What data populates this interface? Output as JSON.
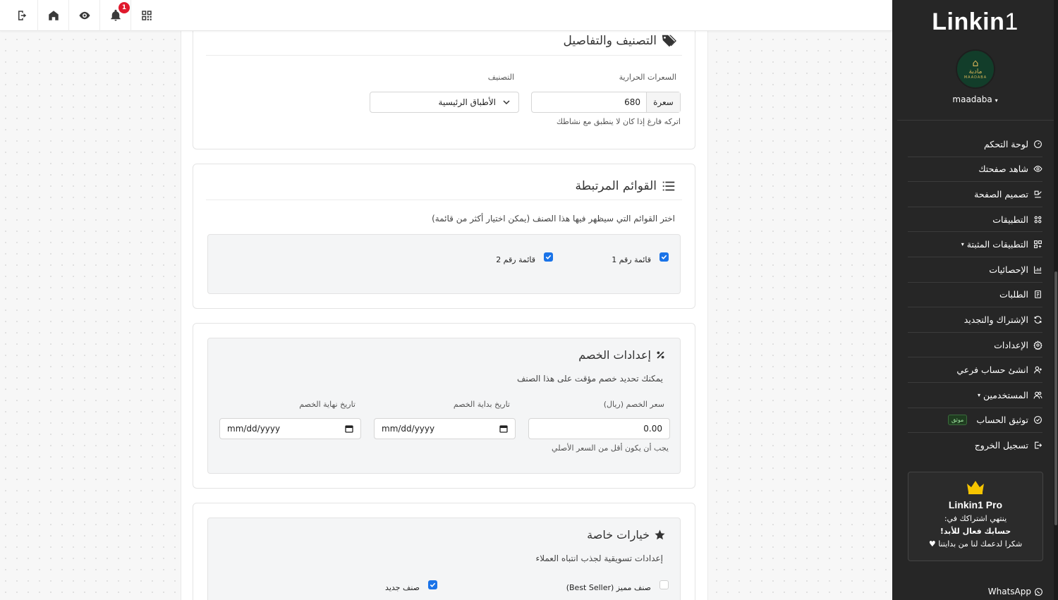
{
  "topbar": {
    "notification_count": "1",
    "icons": [
      "logout-icon",
      "home-icon",
      "eye-icon",
      "bell-icon",
      "qr-code-icon"
    ]
  },
  "category_card": {
    "title": "التصنيف والتفاصيل",
    "calories_label": "السعرات الحرارية",
    "calories_unit": "سعرة",
    "calories_value": "680",
    "calories_help": "اتركه فارغ إذا كان لا ينطبق مع نشاطك",
    "category_label": "التصنيف",
    "category_value": "الأطباق الرئيسية"
  },
  "lists_card": {
    "title": "القوائم المرتبطة",
    "description": "اختر القوائم التي سيظهر فيها هذا الصنف (يمكن اختيار أكثر من قائمة)",
    "items": [
      {
        "label": "قائمة رقم 1",
        "checked": true
      },
      {
        "label": "قائمة رقم 2",
        "checked": true
      }
    ]
  },
  "discount_card": {
    "title": "إعدادات الخصم",
    "description": "يمكنك تحديد خصم مؤقت على هذا الصنف",
    "price_label": "سعر الخصم (ريال)",
    "price_value": "0.00",
    "price_help": "يجب أن يكون أقل من السعر الأصلي",
    "start_label": "تاريخ بداية الخصم",
    "start_placeholder": "mm/dd/yyyy",
    "end_label": "تاريخ نهاية الخصم",
    "end_placeholder": "mm/dd/yyyy"
  },
  "special_card": {
    "title": "خيارات خاصة",
    "description": "إعدادات تسويقية لجذب انتباه العملاء",
    "options": [
      {
        "label": "صنف مميز (Best Seller)",
        "checked": false
      },
      {
        "label": "صنف جديد",
        "checked": true
      }
    ]
  },
  "sidebar": {
    "logo_bold": "Linkin",
    "logo_thin": "1",
    "avatar_arabic": "مادبة",
    "avatar_english": "MAADABA",
    "username": "maadaba",
    "nav": [
      {
        "label": "لوحة التحكم",
        "icon": "dashboard-icon"
      },
      {
        "label": "شاهد صفحتك",
        "icon": "eye-icon"
      },
      {
        "label": "تصميم الصفحة",
        "icon": "edit-icon"
      },
      {
        "label": "التطبيقات",
        "icon": "apps-icon"
      },
      {
        "label": "التطبيقات المثبتة",
        "icon": "installed-apps-icon",
        "caret": true
      },
      {
        "label": "الإحصائيات",
        "icon": "stats-icon"
      },
      {
        "label": "الطلبات",
        "icon": "orders-icon"
      },
      {
        "label": "الإشتراك والتجديد",
        "icon": "refresh-icon"
      },
      {
        "label": "الإعدادات",
        "icon": "settings-icon"
      },
      {
        "label": "انشئ حساب فرعي",
        "icon": "add-user-icon"
      },
      {
        "label": "المستخدمين",
        "icon": "users-icon",
        "caret": true
      },
      {
        "label": "توثيق الحساب",
        "icon": "verify-icon",
        "badge": "موثق"
      },
      {
        "label": "تسجيل الخروج",
        "icon": "logout-icon"
      }
    ],
    "pro": {
      "title": "Linkin1 Pro",
      "line1": "ينتهي اشتراكك في:",
      "line2": "حسابك فعال للأبد!",
      "line3": "شكرا لدعمك لنا من بدايتنا"
    },
    "whatsapp": "WhatsApp"
  },
  "colors": {
    "accent": "#1a73e8",
    "sidebar": "#262626",
    "badge": "#e0192d",
    "crown": "#f5c400"
  }
}
